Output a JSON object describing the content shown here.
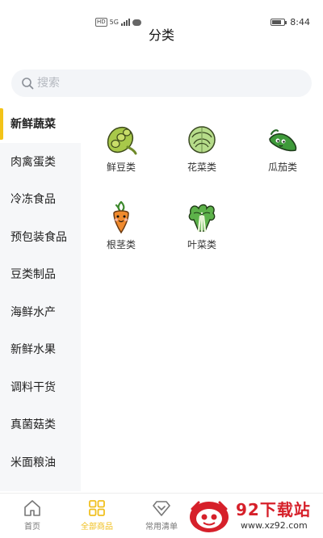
{
  "status_bar": {
    "network": "HD",
    "signal": "5G",
    "time": "8:44"
  },
  "header": {
    "title": "分类"
  },
  "search": {
    "placeholder": "搜索"
  },
  "sidebar": {
    "items": [
      {
        "label": "新鲜蔬菜",
        "active": true
      },
      {
        "label": "肉禽蛋类",
        "active": false
      },
      {
        "label": "冷冻食品",
        "active": false
      },
      {
        "label": "预包装食品",
        "active": false
      },
      {
        "label": "豆类制品",
        "active": false
      },
      {
        "label": "海鲜水产",
        "active": false
      },
      {
        "label": "新鲜水果",
        "active": false
      },
      {
        "label": "调料干货",
        "active": false
      },
      {
        "label": "真菌菇类",
        "active": false
      },
      {
        "label": "米面粮油",
        "active": false
      }
    ]
  },
  "categories": [
    {
      "label": "鲜豆类",
      "icon": "edamame-icon"
    },
    {
      "label": "花菜类",
      "icon": "cabbage-icon"
    },
    {
      "label": "瓜茄类",
      "icon": "pea-pod-icon"
    },
    {
      "label": "根茎类",
      "icon": "carrot-icon"
    },
    {
      "label": "叶菜类",
      "icon": "leafy-greens-icon"
    }
  ],
  "tabbar": {
    "items": [
      {
        "label": "首页",
        "icon": "home-icon",
        "active": false
      },
      {
        "label": "全部商品",
        "icon": "grid-icon",
        "active": true
      },
      {
        "label": "常用清单",
        "icon": "diamond-icon",
        "active": false
      }
    ]
  },
  "watermark": {
    "title": "92下载站",
    "url": "www.xz92.com"
  },
  "colors": {
    "accent": "#f3c318",
    "sidebar_bg": "#f6f7f9",
    "watermark_red": "#d6202a"
  }
}
